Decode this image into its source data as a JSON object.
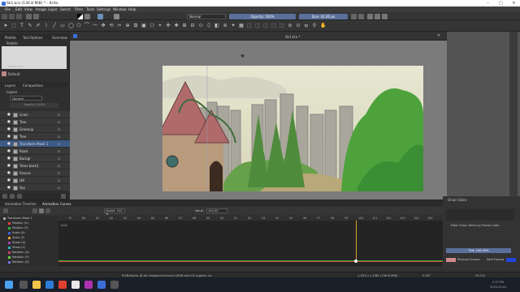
{
  "window": {
    "title": "Sk1.kra (136.8 MiB) * - Krita"
  },
  "menu": [
    "File",
    "Edit",
    "View",
    "Image",
    "Layer",
    "Select",
    "Filter",
    "Tools",
    "Settings",
    "Window",
    "Help"
  ],
  "brush_bar": {
    "opacity_label": "Opacity: 100%",
    "size_label": "Size: 42.00 px"
  },
  "document_tab": "Sk1.kra *",
  "left_dock": {
    "tabs": [
      "Palette",
      "Tool Options",
      "Overview"
    ],
    "palette_title": "Palette",
    "palette_name": "Default",
    "advanced_label": "Advanced",
    "layers_tabs": [
      "Layers",
      "Composition"
    ],
    "layers_title": "Layers",
    "blending": "Normal",
    "opacity_label": "Opacity: 100%",
    "layers": [
      {
        "name": "Lines",
        "selected": false
      },
      {
        "name": "Tree",
        "selected": false
      },
      {
        "name": "Greenup",
        "selected": false
      },
      {
        "name": "Tree",
        "selected": false
      },
      {
        "name": "Transform Mask 1",
        "selected": true
      },
      {
        "name": "Road",
        "selected": false
      },
      {
        "name": "Backgr",
        "selected": false
      },
      {
        "name": "Trees back1",
        "selected": false
      },
      {
        "name": "Fences",
        "selected": false
      },
      {
        "name": "Hill",
        "selected": false
      },
      {
        "name": "Sky",
        "selected": false
      }
    ]
  },
  "timeline": {
    "tabs": [
      "Animation Timeline",
      "Animation Curves"
    ],
    "speed_label": "Speed: 100 %",
    "value_label": "Value:",
    "value": "144.00",
    "frames": [
      "79",
      "80",
      "81",
      "82",
      "83",
      "84",
      "85",
      "86",
      "87",
      "88",
      "89",
      "90",
      "91",
      "92",
      "93",
      "94",
      "95",
      "96",
      "97",
      "98",
      "99",
      "100",
      "101",
      "102",
      "103",
      "104",
      "105"
    ],
    "y_ticks": [
      "1000",
      "0"
    ],
    "channels": [
      {
        "name": "Transform Mask 1",
        "color": "#aaaaaa"
      },
      {
        "name": "Position (X)",
        "color": "#e0403a"
      },
      {
        "name": "Position (Y)",
        "color": "#2fb53a"
      },
      {
        "name": "Scale (X)",
        "color": "#4062e0"
      },
      {
        "name": "Scale (Y)",
        "color": "#e0a030"
      },
      {
        "name": "Shear (X)",
        "color": "#b040b0"
      },
      {
        "name": "Shear (Y)",
        "color": "#30b0b0"
      },
      {
        "name": "Rotation (X)",
        "color": "#d04070"
      },
      {
        "name": "Rotation (Y)",
        "color": "#70d040"
      },
      {
        "name": "Rotation (Z)",
        "color": "#7070e0"
      }
    ]
  },
  "onion": {
    "title": "Onion Skins",
    "filter_label": "Filter Onion Skins by Frame Color",
    "tint_label": "Tint: 100.00%",
    "previous_label": "Previous Frames",
    "next_label": "Next Frames",
    "previous_color": "#d08a8a",
    "next_color": "#2244dd"
  },
  "status": {
    "color_info": "RGB/Alpha (8-bit integer/channel)  sRGB-elle-V2-srgbtrc.icc",
    "dims": "1,920 x 1,080 (136.8 MiB)",
    "angle": "0.00°",
    "zoom": "30.2%"
  },
  "taskbar": {
    "time": "2:37 PM",
    "date": "2023-03-02"
  }
}
